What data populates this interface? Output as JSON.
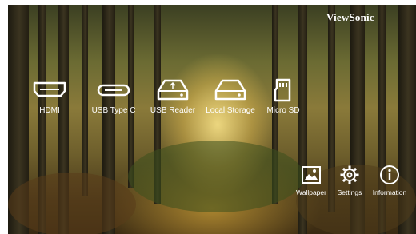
{
  "brand": {
    "logo_text": "ViewSonic"
  },
  "sources": [
    {
      "label": "HDMI",
      "icon": "hdmi-icon"
    },
    {
      "label": "USB Type C",
      "icon": "usb-type-c-icon"
    },
    {
      "label": "USB Reader",
      "icon": "usb-reader-icon"
    },
    {
      "label": "Local Storage",
      "icon": "local-storage-icon"
    },
    {
      "label": "Micro SD",
      "icon": "micro-sd-icon"
    }
  ],
  "tools": [
    {
      "label": "Wallpaper",
      "icon": "wallpaper-icon"
    },
    {
      "label": "Settings",
      "icon": "gear-icon"
    },
    {
      "label": "Information",
      "icon": "info-icon"
    }
  ],
  "colors": {
    "text": "#ffffff"
  }
}
